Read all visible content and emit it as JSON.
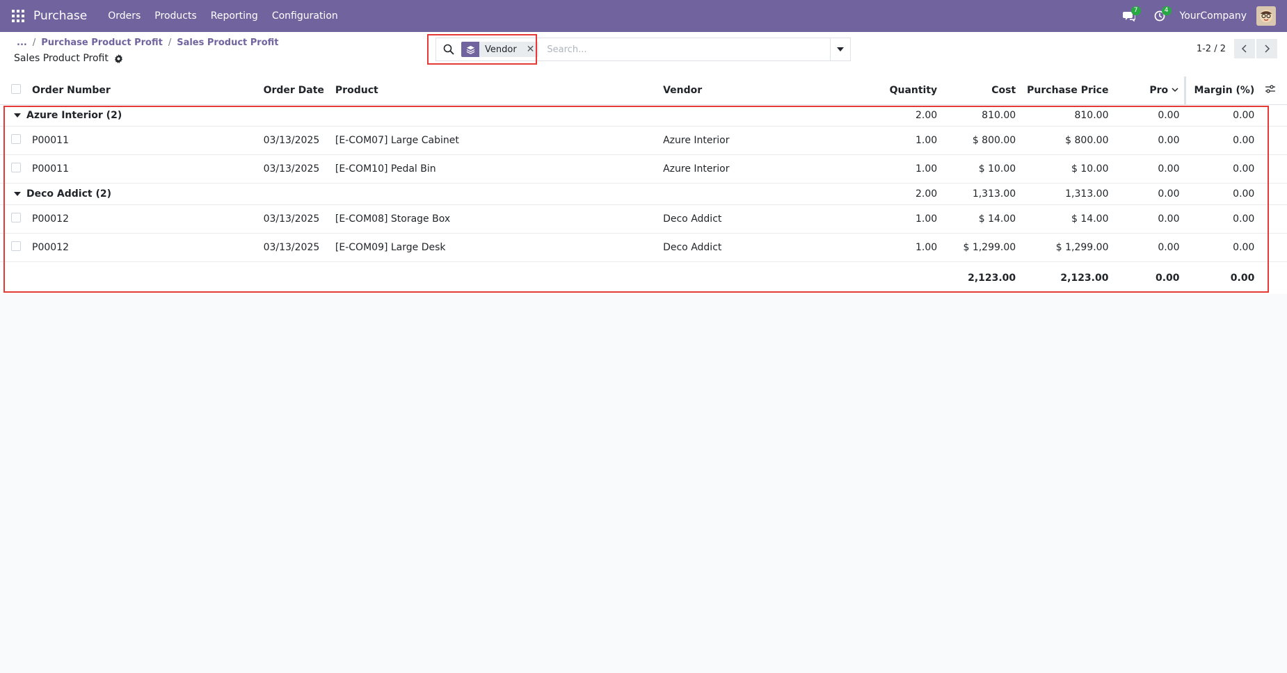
{
  "app": {
    "name": "Purchase",
    "menu": [
      "Orders",
      "Products",
      "Reporting",
      "Configuration"
    ],
    "company": "YourCompany",
    "messages_badge": "7",
    "activities_badge": "4"
  },
  "breadcrumb": {
    "ellipsis": "...",
    "items": [
      "Purchase Product Profit",
      "Sales Product Profit"
    ]
  },
  "page_title": "Sales Product Profit",
  "search": {
    "facet_label": "Vendor",
    "placeholder": "Search..."
  },
  "pager": {
    "value": "1-2 / 2"
  },
  "table": {
    "columns": [
      "Order Number",
      "Order Date",
      "Product",
      "Vendor",
      "Quantity",
      "Cost",
      "Purchase Price",
      "Pro",
      "Margin (%)"
    ],
    "groups": [
      {
        "label": "Azure Interior (2)",
        "quantity": "2.00",
        "cost": "810.00",
        "purchase_price": "810.00",
        "profit": "0.00",
        "margin": "0.00",
        "rows": [
          {
            "order": "P00011",
            "date": "03/13/2025",
            "product": "[E-COM07] Large Cabinet",
            "vendor": "Azure Interior",
            "quantity": "1.00",
            "cost": "$ 800.00",
            "purchase_price": "$ 800.00",
            "profit": "0.00",
            "margin": "0.00"
          },
          {
            "order": "P00011",
            "date": "03/13/2025",
            "product": "[E-COM10] Pedal Bin",
            "vendor": "Azure Interior",
            "quantity": "1.00",
            "cost": "$ 10.00",
            "purchase_price": "$ 10.00",
            "profit": "0.00",
            "margin": "0.00"
          }
        ]
      },
      {
        "label": "Deco Addict (2)",
        "quantity": "2.00",
        "cost": "1,313.00",
        "purchase_price": "1,313.00",
        "profit": "0.00",
        "margin": "0.00",
        "rows": [
          {
            "order": "P00012",
            "date": "03/13/2025",
            "product": "[E-COM08] Storage Box",
            "vendor": "Deco Addict",
            "quantity": "1.00",
            "cost": "$ 14.00",
            "purchase_price": "$ 14.00",
            "profit": "0.00",
            "margin": "0.00"
          },
          {
            "order": "P00012",
            "date": "03/13/2025",
            "product": "[E-COM09] Large Desk",
            "vendor": "Deco Addict",
            "quantity": "1.00",
            "cost": "$ 1,299.00",
            "purchase_price": "$ 1,299.00",
            "profit": "0.00",
            "margin": "0.00"
          }
        ]
      }
    ],
    "totals": {
      "cost": "2,123.00",
      "purchase_price": "2,123.00",
      "profit": "0.00",
      "margin": "0.00"
    }
  },
  "colors": {
    "brand": "#71639e",
    "highlight": "#e53935"
  }
}
